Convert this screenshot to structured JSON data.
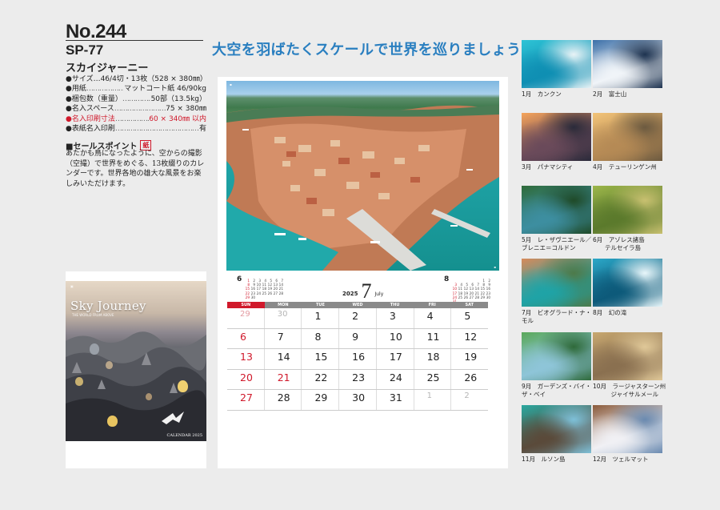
{
  "product": {
    "number": "No.244",
    "code": "SP-77",
    "name": "スカイジャーニー"
  },
  "specs": [
    {
      "key": "●サイズ…46/4切・13枚（528 × 380㎜）",
      "value": "",
      "red": false,
      "nodots": true
    },
    {
      "key": "●用紙",
      "value": "マットコート紙 46/90kg",
      "red": false
    },
    {
      "key": "●梱包数（重量）",
      "value": "50部（13.5kg）",
      "red": false
    },
    {
      "key": "●名入スペース",
      "value": "75 × 380㎜",
      "red": false
    },
    {
      "key": "●名入印刷寸法",
      "value": "60 × 340㎜ 以内",
      "red": true
    },
    {
      "key": "●表紙名入印刷",
      "value": "有",
      "red": false
    }
  ],
  "sales": {
    "heading": "■セールスポイント",
    "badge": "紙",
    "text": "あたかも鳥になったように、空からの撮影（空撮）で世界をめぐる、13枚綴りのカレンダーです。世界各地の雄大な風景をお楽しみいただけます。"
  },
  "cover": {
    "title": "Sky Journey",
    "subtitle": "THE WORLD FROM ABOVE",
    "footer": "CALENDAR 2025"
  },
  "headline": "大空を羽ばたくスケールで世界を巡りましょう",
  "calendar": {
    "year": "2025",
    "month": "7",
    "month_en": "July",
    "weekdays": [
      "SUN",
      "MON",
      "TUE",
      "WED",
      "THU",
      "FRI",
      "SAT"
    ],
    "weeks": [
      [
        {
          "d": "29",
          "t": "othersun"
        },
        {
          "d": "30",
          "t": "other"
        },
        {
          "d": "1"
        },
        {
          "d": "2"
        },
        {
          "d": "3"
        },
        {
          "d": "4"
        },
        {
          "d": "5"
        }
      ],
      [
        {
          "d": "6",
          "t": "hol"
        },
        {
          "d": "7"
        },
        {
          "d": "8"
        },
        {
          "d": "9"
        },
        {
          "d": "10"
        },
        {
          "d": "11"
        },
        {
          "d": "12"
        }
      ],
      [
        {
          "d": "13",
          "t": "hol"
        },
        {
          "d": "14"
        },
        {
          "d": "15"
        },
        {
          "d": "16"
        },
        {
          "d": "17"
        },
        {
          "d": "18"
        },
        {
          "d": "19"
        }
      ],
      [
        {
          "d": "20",
          "t": "hol"
        },
        {
          "d": "21",
          "t": "hol"
        },
        {
          "d": "22"
        },
        {
          "d": "23"
        },
        {
          "d": "24"
        },
        {
          "d": "25"
        },
        {
          "d": "26"
        }
      ],
      [
        {
          "d": "27",
          "t": "hol"
        },
        {
          "d": "28"
        },
        {
          "d": "29"
        },
        {
          "d": "30"
        },
        {
          "d": "31"
        },
        {
          "d": "1",
          "t": "other"
        },
        {
          "d": "2",
          "t": "other"
        }
      ]
    ],
    "prev_mini": {
      "num": "6",
      "rows": [
        [
          "1",
          "2",
          "3",
          "4",
          "5",
          "6",
          "7"
        ],
        [
          "8",
          "9",
          "10",
          "11",
          "12",
          "13",
          "14"
        ],
        [
          "15",
          "16",
          "17",
          "18",
          "19",
          "20",
          "21"
        ],
        [
          "22",
          "23",
          "24",
          "25",
          "26",
          "27",
          "28"
        ],
        [
          "29",
          "30",
          "",
          "",
          "",
          "",
          ""
        ]
      ]
    },
    "next_mini": {
      "num": "8",
      "rows": [
        [
          "",
          "",
          "",
          "",
          "",
          "1",
          "2"
        ],
        [
          "3",
          "4",
          "5",
          "6",
          "7",
          "8",
          "9"
        ],
        [
          "10",
          "11",
          "12",
          "13",
          "14",
          "15",
          "16"
        ],
        [
          "17",
          "18",
          "19",
          "20",
          "21",
          "22",
          "23"
        ],
        [
          "24",
          "25",
          "26",
          "27",
          "28",
          "29",
          "30"
        ],
        [
          "31",
          "",
          "",
          "",
          "",
          "",
          ""
        ]
      ]
    }
  },
  "months": [
    {
      "label": "1月　カンクン",
      "colors": [
        "#2ec4d6",
        "#0f8fb3",
        "#e8f3f6"
      ]
    },
    {
      "label": "2月　富士山",
      "colors": [
        "#3b6fa8",
        "#f0f4f8",
        "#1e3350"
      ]
    },
    {
      "label": "3月　パナマシティ",
      "colors": [
        "#f6a45a",
        "#6a4a5a",
        "#2a2a3a"
      ]
    },
    {
      "label": "4月　テューリンゲン州",
      "colors": [
        "#f3c478",
        "#b58a55",
        "#6c5a40"
      ]
    },
    {
      "label": "5月　レ・ザヴニエール／\nブレニエ＝コルドン",
      "colors": [
        "#2f6b3a",
        "#3d8ea0",
        "#1f4a28"
      ]
    },
    {
      "label": "6月　アゾレス諸島\n　　テルセイラ島",
      "colors": [
        "#9cb64a",
        "#5b7a2c",
        "#c8c070"
      ]
    },
    {
      "label": "7月　ビオグラード・ナ・\nモル",
      "colors": [
        "#d88a5a",
        "#1fa3a6",
        "#4d7a4a"
      ]
    },
    {
      "label": "8月　幻の滝",
      "colors": [
        "#2ba8c8",
        "#0d5a7a",
        "#e8f6fa"
      ]
    },
    {
      "label": "9月　ガーデンズ・バイ・\nザ・ベイ",
      "colors": [
        "#5aa85a",
        "#8ec5d8",
        "#2f6a3a"
      ]
    },
    {
      "label": "10月　ラージャスターン州\n　　　ジャイサルメール",
      "colors": [
        "#c8a870",
        "#8a7050",
        "#e0c898"
      ]
    },
    {
      "label": "11月　ルソン島",
      "colors": [
        "#2aa8a0",
        "#5a4a3a",
        "#7ec0d8"
      ]
    },
    {
      "label": "12月　ツェルマット",
      "colors": [
        "#8a5a3a",
        "#f0f0f4",
        "#6a8ab0"
      ]
    }
  ]
}
